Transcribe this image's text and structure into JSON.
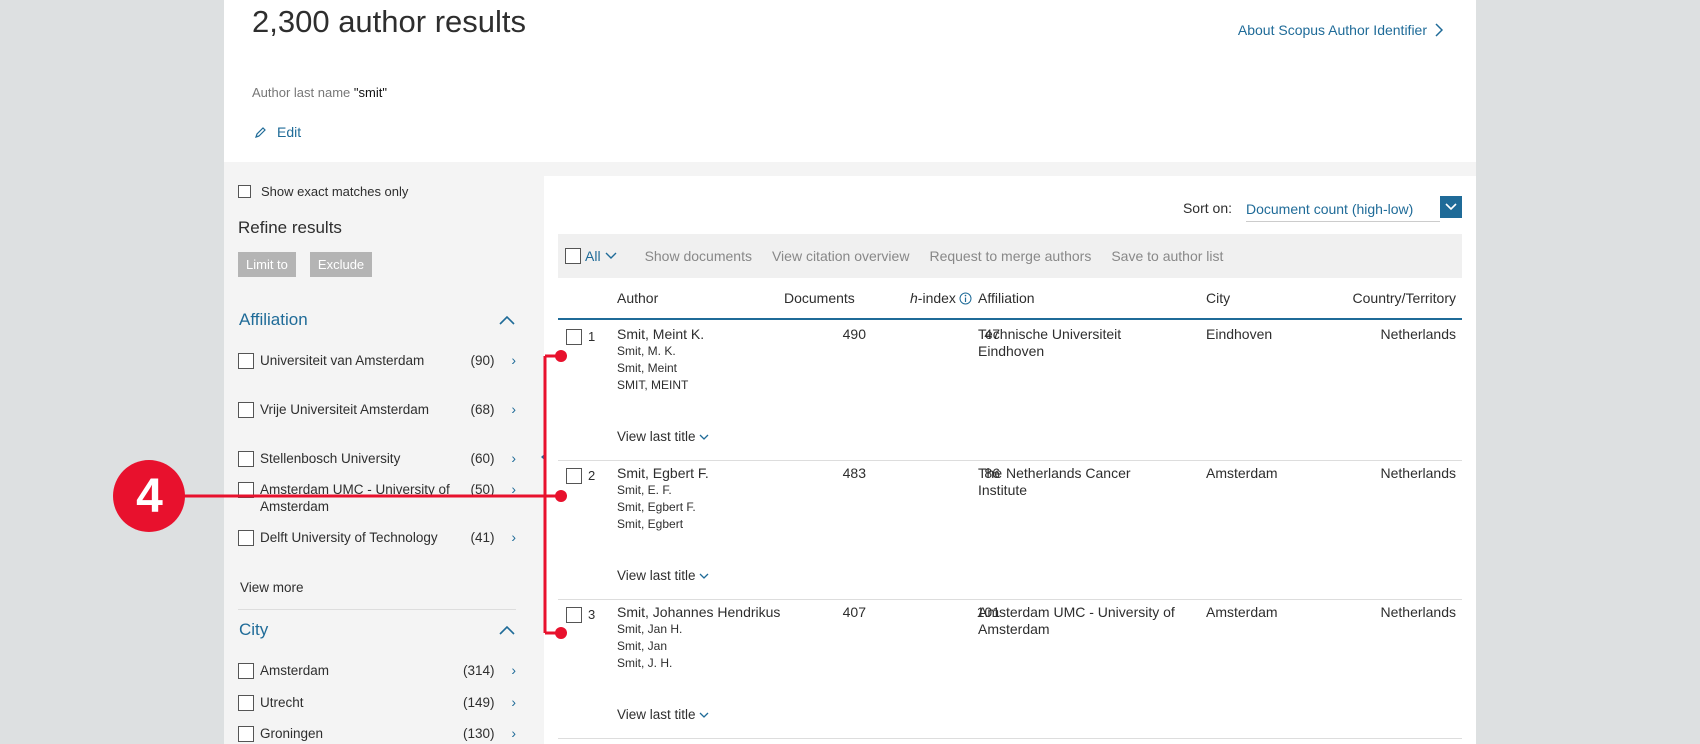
{
  "header": {
    "title": "2,300 author results",
    "about_link": "About Scopus Author Identifier",
    "query_label": "Author last name",
    "query_value": "\"smit\"",
    "edit_label": "Edit"
  },
  "sidebar": {
    "exact_label": "Show exact matches only",
    "refine_title": "Refine results",
    "limit_label": "Limit to",
    "exclude_label": "Exclude",
    "affiliation": {
      "title": "Affiliation",
      "items": [
        {
          "name": "Universiteit van Amsterdam",
          "count": "(90)"
        },
        {
          "name": "Vrije Universiteit Amsterdam",
          "count": "(68)"
        },
        {
          "name": "Stellenbosch University",
          "count": "(60)"
        },
        {
          "name": "Amsterdam UMC - University of Amsterdam",
          "count": "(50)"
        },
        {
          "name": "Delft University of Technology",
          "count": "(41)"
        }
      ],
      "view_more": "View more"
    },
    "city": {
      "title": "City",
      "items": [
        {
          "name": "Amsterdam",
          "count": "(314)"
        },
        {
          "name": "Utrecht",
          "count": "(149)"
        },
        {
          "name": "Groningen",
          "count": "(130)"
        }
      ]
    }
  },
  "results": {
    "sort_label": "Sort on:",
    "sort_value": "Document count (high-low)",
    "toolbar": {
      "all": "All",
      "show_documents": "Show documents",
      "view_citation": "View citation overview",
      "request_merge": "Request to merge authors",
      "save_list": "Save to author list"
    },
    "columns": {
      "author": "Author",
      "documents": "Documents",
      "h_italic": "h",
      "hindex_rest": "-index",
      "affiliation": "Affiliation",
      "city": "City",
      "country": "Country/Territory"
    },
    "rows": [
      {
        "num": "1",
        "name": "Smit, Meint K.",
        "aliases": [
          "Smit, M. K.",
          "Smit, Meint",
          "SMIT, MEINT"
        ],
        "documents": "490",
        "hindex": "47",
        "affiliation": "Technische Universiteit Eindhoven",
        "city": "Eindhoven",
        "country": "Netherlands",
        "view_last": "View last title"
      },
      {
        "num": "2",
        "name": "Smit, Egbert F.",
        "aliases": [
          "Smit, E. F.",
          "Smit, Egbert F.",
          "Smit, Egbert"
        ],
        "documents": "483",
        "hindex": "86",
        "affiliation": "The Netherlands Cancer Institute",
        "city": "Amsterdam",
        "country": "Netherlands",
        "view_last": "View last title"
      },
      {
        "num": "3",
        "name": "Smit, Johannes Hendrikus",
        "aliases": [
          "Smit, Jan H.",
          "Smit, Jan",
          "Smit, J. H."
        ],
        "documents": "407",
        "hindex": "101",
        "affiliation": "Amsterdam UMC - University of Amsterdam",
        "city": "Amsterdam",
        "country": "Netherlands",
        "view_last": "View last title"
      }
    ]
  },
  "callout": {
    "number": "4",
    "color": "#e8112d"
  }
}
